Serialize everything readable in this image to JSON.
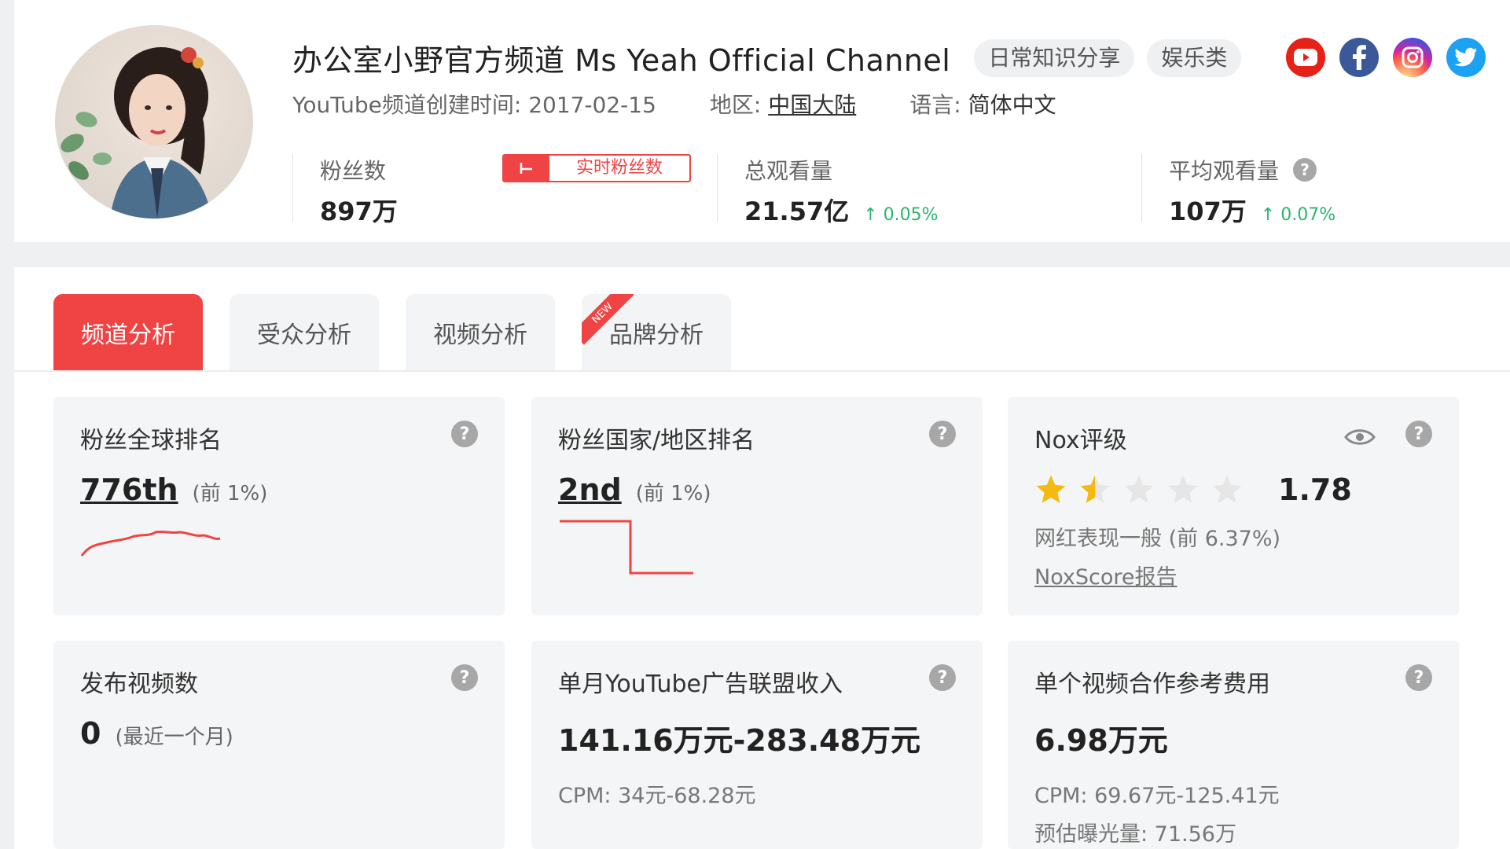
{
  "channel": {
    "title": "办公室小野官方频道 Ms Yeah Official Channel",
    "tags": [
      "日常知识分享",
      "娱乐类"
    ],
    "created": "YouTube频道创建时间: 2017-02-15",
    "region_label": "地区:",
    "region_value": "中国大陆",
    "language_label": "语言:",
    "language_value": "简体中文",
    "socials": [
      {
        "name": "youtube-icon",
        "color": "#e62117"
      },
      {
        "name": "facebook-icon",
        "color": "#3b5998"
      },
      {
        "name": "instagram-icon",
        "color": "#d6249f"
      },
      {
        "name": "twitter-icon",
        "color": "#1da1f2"
      }
    ]
  },
  "stats": {
    "subscribers": {
      "label": "粉丝数",
      "value": "897万"
    },
    "live_button": "实时粉丝数",
    "total_views": {
      "label": "总观看量",
      "value": "21.57亿",
      "growth": "0.05%"
    },
    "avg_views": {
      "label": "平均观看量",
      "value": "107万",
      "growth": "0.07%"
    }
  },
  "tabs": [
    {
      "label": "频道分析",
      "active": true
    },
    {
      "label": "受众分析",
      "active": false
    },
    {
      "label": "视频分析",
      "active": false
    },
    {
      "label": "品牌分析",
      "active": false,
      "badge": "NEW"
    }
  ],
  "cards": {
    "global_rank": {
      "title": "粉丝全球排名",
      "value": "776th",
      "sub": "(前 1%)"
    },
    "country_rank": {
      "title": "粉丝国家/地区排名",
      "value": "2nd",
      "sub": "(前 1%)"
    },
    "nox": {
      "title": "Nox评级",
      "rating": "1.78",
      "stars_filled": 1.5,
      "stars_total": 5,
      "desc": "网红表现一般 (前 6.37%)",
      "link": "NoxScore报告"
    },
    "videos": {
      "title": "发布视频数",
      "value": "0",
      "sub": "(最近一个月)"
    },
    "ad_income": {
      "title": "单月YouTube广告联盟收入",
      "value": "141.16万元-283.48万元",
      "cpm": "CPM: 34元-68.28元"
    },
    "collab_fee": {
      "title": "单个视频合作参考费用",
      "value": "6.98万元",
      "cpm": "CPM: 69.67元-125.41元",
      "exposure": "预估曝光量: 71.56万"
    }
  },
  "colors": {
    "accent": "#f04444",
    "growth": "#2db56d",
    "star": "#f5b90f"
  },
  "help_glyph": "?",
  "growth_arrow": "↑"
}
